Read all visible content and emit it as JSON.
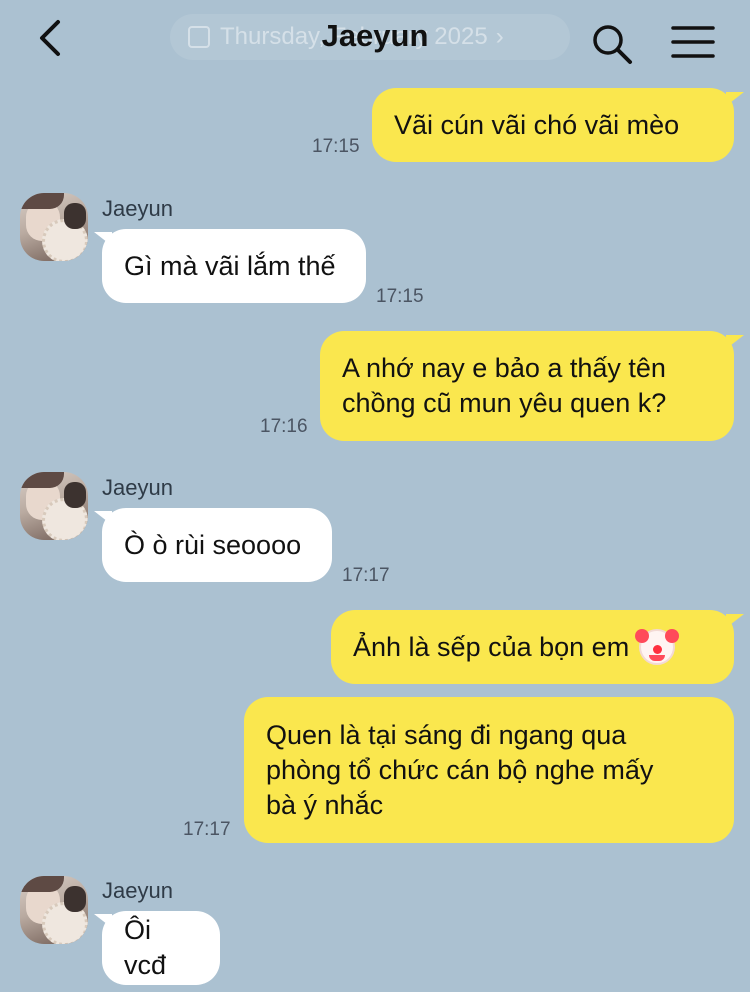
{
  "header": {
    "title": "Jaeyun",
    "date_banner": "Thursday, February 2025"
  },
  "icons": {
    "back": "chevron-left-icon",
    "search": "search-icon",
    "menu": "menu-icon",
    "calendar": "calendar-icon"
  },
  "colors": {
    "background": "#abc1d1",
    "outgoing_bubble": "#fae74e",
    "incoming_bubble": "#ffffff"
  },
  "messages": [
    {
      "direction": "out",
      "text": "Vãi cún vãi chó vãi mèo",
      "time": "17:15"
    },
    {
      "direction": "in",
      "sender": "Jaeyun",
      "text": "Gì mà vãi lắm thế",
      "time": "17:15"
    },
    {
      "direction": "out",
      "text": "A nhớ nay e bảo a thấy tên\nchồng cũ mun yêu quen k?",
      "time": "17:16"
    },
    {
      "direction": "in",
      "sender": "Jaeyun",
      "text": "Ò ò rùi seoooo",
      "time": "17:17"
    },
    {
      "direction": "out",
      "text": "Ảnh là sếp của bọn em",
      "emoji": "clown-face",
      "time": ""
    },
    {
      "direction": "out",
      "text": "Quen là tại sáng đi ngang qua\nphòng tổ chức cán bộ nghe mấy\nbà ý nhắc",
      "time": "17:17"
    },
    {
      "direction": "in",
      "sender": "Jaeyun",
      "text": "Ôi vcđ",
      "time": ""
    }
  ]
}
